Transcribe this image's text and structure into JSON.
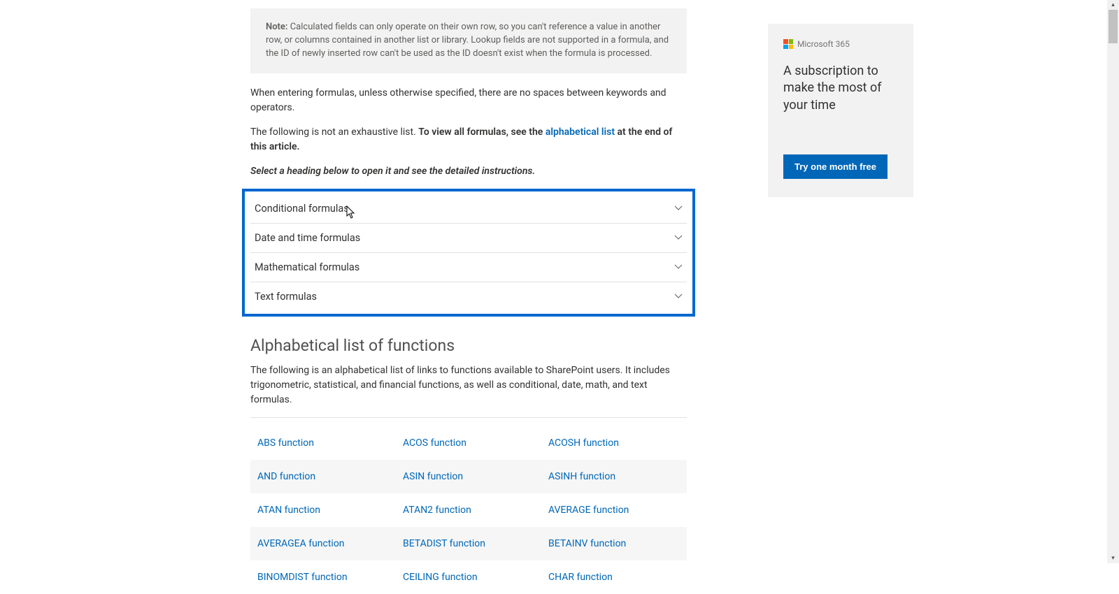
{
  "note": {
    "label": "Note:",
    "text": " Calculated fields can only operate on their own row, so you can't reference a value in another row, or columns contained in another list or library. Lookup fields are not supported in a formula, and the ID of newly inserted row can't be used as the ID doesn't exist when the formula is processed."
  },
  "para_spaces": "When entering formulas, unless otherwise specified, there are no spaces between keywords and operators.",
  "para_exhaustive_prefix": "The following is not an exhaustive list. ",
  "para_exhaustive_bold_pre": "To view all formulas, see the ",
  "para_exhaustive_link": "alphabetical list",
  "para_exhaustive_bold_post": " at the end of this article.",
  "select_heading": "Select a heading below to open it and see the detailed instructions.",
  "accordion": [
    "Conditional formulas",
    "Date and time formulas",
    "Mathematical formulas",
    "Text formulas"
  ],
  "alpha_heading": "Alphabetical list of functions",
  "alpha_intro": "The following is an alphabetical list of links to functions available to SharePoint users. It includes trigonometric, statistical, and financial functions, as well as conditional, date, math, and text formulas.",
  "functions": [
    [
      "ABS function",
      "ACOS function",
      "ACOSH function"
    ],
    [
      "AND function",
      "ASIN function",
      "ASINH function"
    ],
    [
      "ATAN function",
      "ATAN2 function",
      "AVERAGE function"
    ],
    [
      "AVERAGEA function",
      "BETADIST function",
      "BETAINV function"
    ],
    [
      "BINOMDIST function",
      "CEILING function",
      "CHAR function"
    ]
  ],
  "ad": {
    "brand": "Microsoft 365",
    "headline": "A subscription to make the most of your time",
    "cta": "Try one month free"
  }
}
